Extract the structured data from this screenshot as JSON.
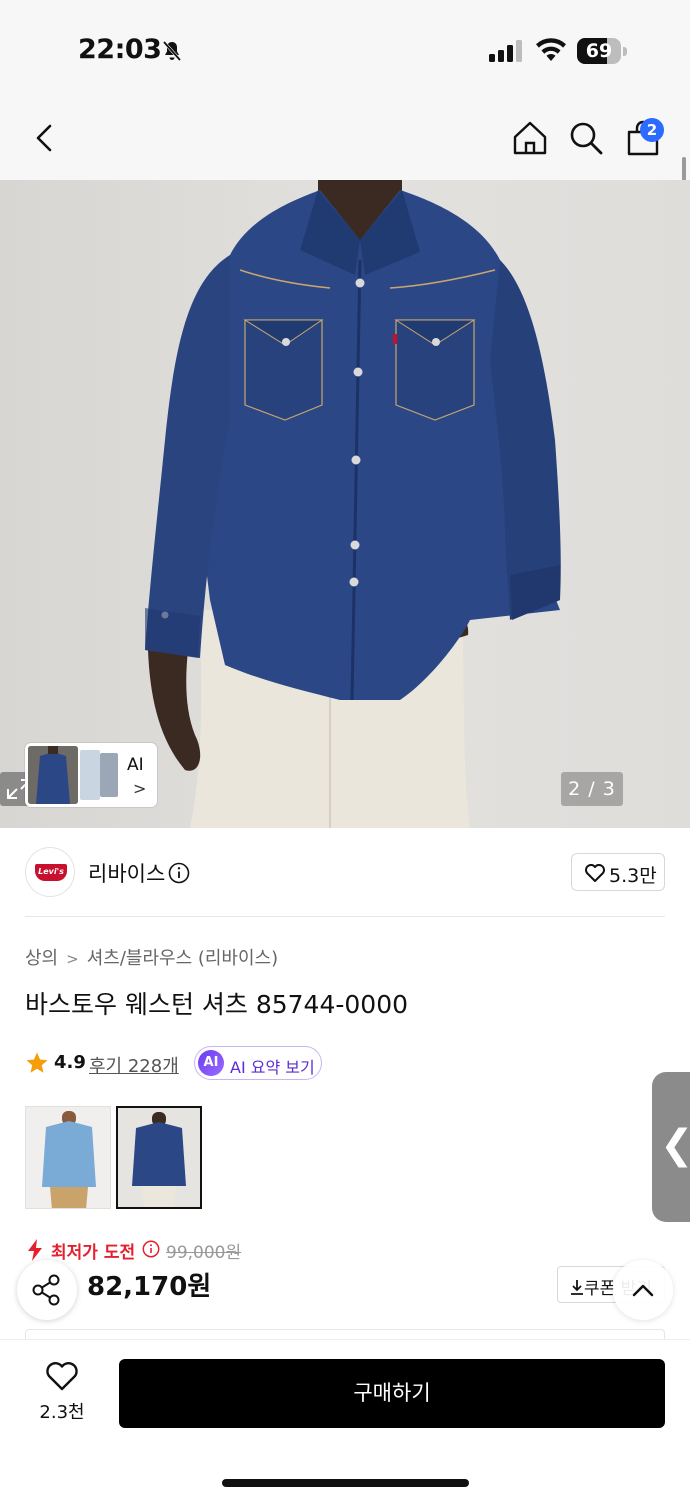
{
  "status_bar": {
    "time": "22:03",
    "battery": "69",
    "battery_fraction": 0.69
  },
  "header": {
    "cart_count": "2"
  },
  "gallery": {
    "ai_label": "AI",
    "ai_arrow": ">",
    "pager": "2 / 3"
  },
  "brand": {
    "name": "리바이스",
    "like_count": "5.3만"
  },
  "breadcrumb": {
    "category": "상의",
    "subcategory": "셔츠/블라우스 (리바이스)"
  },
  "product": {
    "title": "바스토우 웨스턴 셔츠 85744-0000"
  },
  "rating": {
    "score": "4.9",
    "reviews": "후기 228개",
    "ai_badge": "AI",
    "ai_summary": "AI 요약 보기"
  },
  "pricing": {
    "lowest_label": "최저가 도전",
    "original_price": "99,000원",
    "price": "82,170원",
    "coupon_label": "쿠폰 받기"
  },
  "side_tab": {
    "label": "❮"
  },
  "bottom_bar": {
    "wish_count": "2.3천",
    "buy_label": "구매하기"
  },
  "colors": {
    "accent_red": "#e5202e",
    "badge_blue": "#2b6bff",
    "ai_purple": "#6a3cf0",
    "levis_red": "#c8102e"
  }
}
